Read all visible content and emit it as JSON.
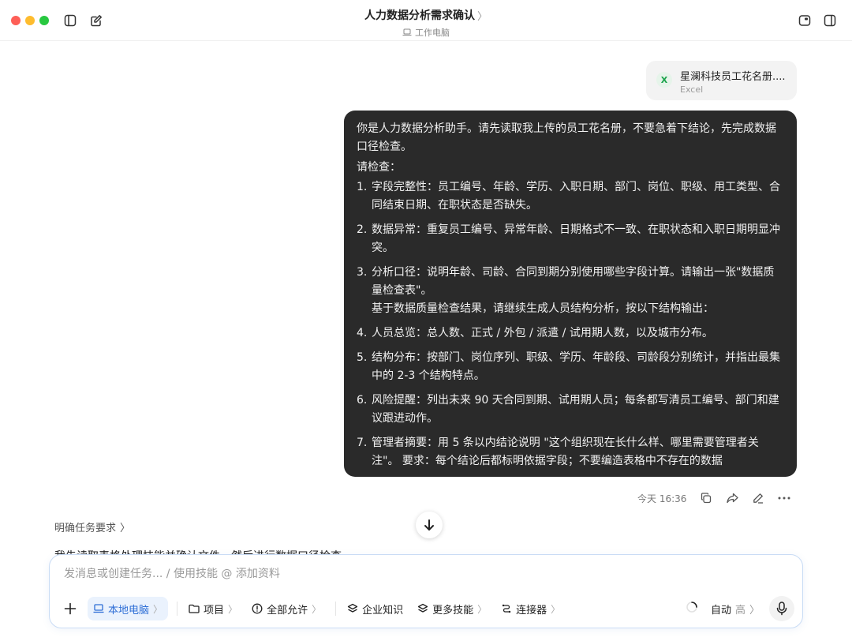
{
  "window": {
    "title": "人力数据分析需求确认",
    "title_chevron": "〉",
    "subtitle": "工作电脑"
  },
  "attachment": {
    "badge": "X",
    "name": "星澜科技员工花名册....",
    "type": "Excel"
  },
  "user_message": {
    "intro": "你是人力数据分析助手。请先读取我上传的员工花名册，不要急着下结论，先完成数据口径检查。",
    "check_label": "请检查：",
    "items": [
      {
        "num": "1.",
        "text": "字段完整性：员工编号、年龄、学历、入职日期、部门、岗位、职级、用工类型、合同结束日期、在职状态是否缺失。"
      },
      {
        "num": "2.",
        "text": "数据异常：重复员工编号、异常年龄、日期格式不一致、在职状态和入职日期明显冲突。"
      },
      {
        "num": "3.",
        "text": "分析口径：说明年龄、司龄、合同到期分别使用哪些字段计算。请输出一张\"数据质量检查表\"。",
        "extra": "基于数据质量检查结果，请继续生成人员结构分析，按以下结构输出："
      },
      {
        "num": "4.",
        "text": "人员总览：总人数、正式 / 外包 / 派遣 / 试用期人数，以及城市分布。"
      },
      {
        "num": "5.",
        "text": "结构分布：按部门、岗位序列、职级、学历、年龄段、司龄段分别统计，并指出最集中的 2-3 个结构特点。"
      },
      {
        "num": "6.",
        "text": "风险提醒：列出未来 90 天合同到期、试用期人员；每条都写清员工编号、部门和建议跟进动作。"
      },
      {
        "num": "7.",
        "text": "管理者摘要：用 5 条以内结论说明 \"这个组织现在长什么样、哪里需要管理者关注\"。 要求：每个结论后都标明依据字段；不要编造表格中不存在的数据"
      }
    ]
  },
  "message_meta": {
    "time": "今天 16:36"
  },
  "assistant": {
    "clarify_label": "明确任务要求",
    "clarify_chevron": "〉",
    "partial_text": "我先读取表格处理技能并确认文件，然后进行数据口径检查。"
  },
  "composer": {
    "placeholder": "发消息或创建任务... / 使用技能 @ 添加资料",
    "value": "",
    "chips": {
      "local_pc": "本地电脑",
      "project": "项目",
      "allow_all": "全部允许",
      "enterprise_knowledge": "企业知识",
      "more_skills": "更多技能",
      "connectors": "连接器"
    },
    "chevron": "〉",
    "mode_label": "自动",
    "mode_level": "高"
  },
  "colors": {
    "accent": "#2f6fd6",
    "bubble": "#2a2a2a",
    "excel_green": "#1aa34a"
  }
}
